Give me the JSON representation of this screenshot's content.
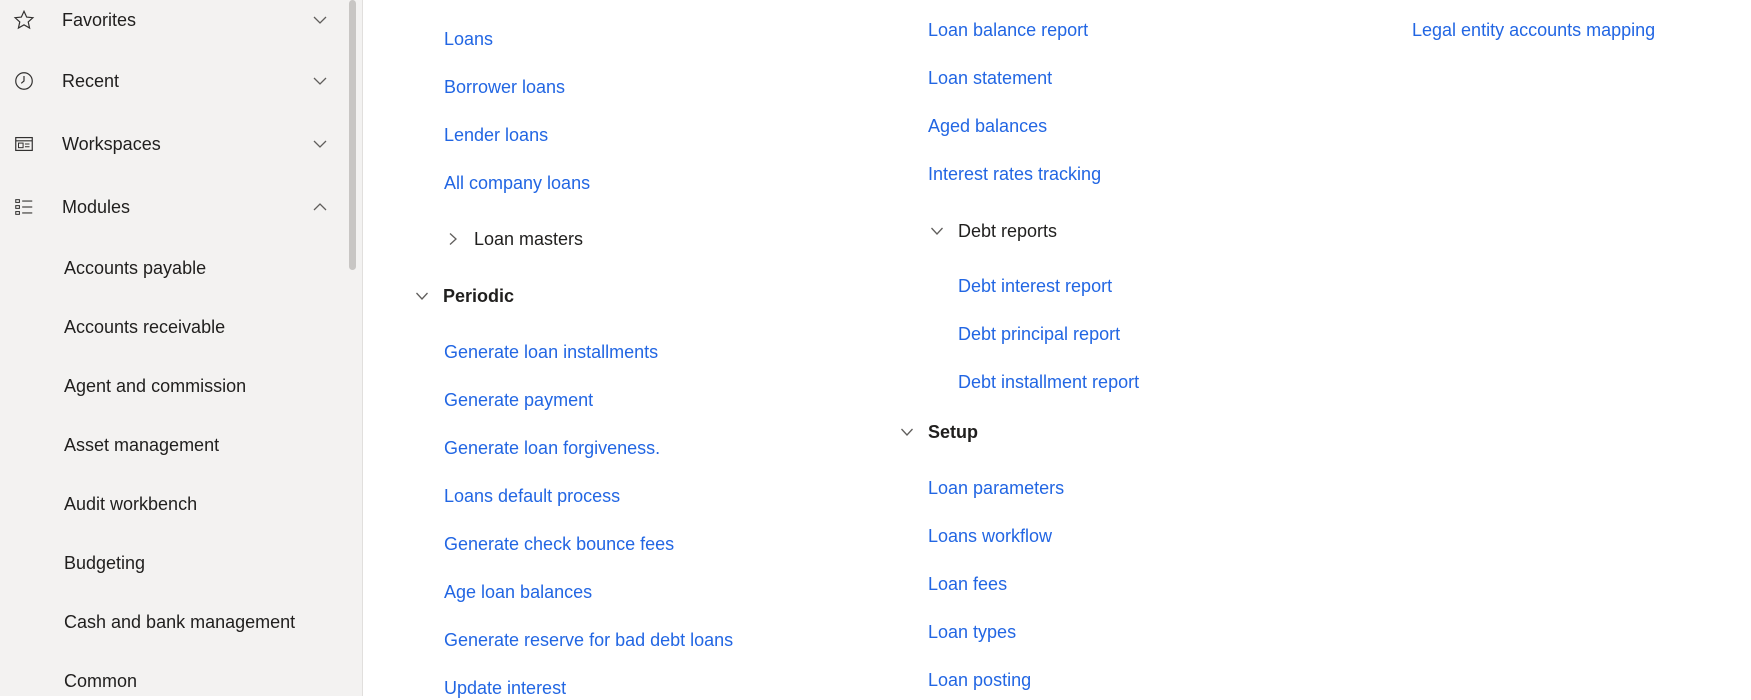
{
  "sidebar": {
    "nav": [
      {
        "label": "Favorites",
        "icon": "star-icon",
        "expanded": false
      },
      {
        "label": "Recent",
        "icon": "clock-icon",
        "expanded": false
      },
      {
        "label": "Workspaces",
        "icon": "workspace-icon",
        "expanded": false
      },
      {
        "label": "Modules",
        "icon": "modules-list-icon",
        "expanded": true
      }
    ],
    "modules": [
      "Accounts payable",
      "Accounts receivable",
      "Agent and commission",
      "Asset management",
      "Audit workbench",
      "Budgeting",
      "Cash and bank management",
      "Common"
    ]
  },
  "column1": {
    "links": [
      "Loans",
      "Borrower loans",
      "Lender loans",
      "All company loans"
    ],
    "loan_masters": {
      "label": "Loan masters",
      "expanded": false
    },
    "periodic": {
      "label": "Periodic",
      "expanded": true,
      "links": [
        "Generate loan installments",
        "Generate payment",
        "Generate loan forgiveness.",
        "Loans default process",
        "Generate check bounce fees",
        "Age loan balances",
        "Generate reserve for bad debt loans",
        "Update interest"
      ]
    }
  },
  "column2": {
    "links": [
      "Loan balance report",
      "Loan statement",
      "Aged balances",
      "Interest rates tracking"
    ],
    "debt_reports": {
      "label": "Debt reports",
      "expanded": true,
      "links": [
        "Debt interest report",
        "Debt principal report",
        "Debt installment report"
      ]
    },
    "setup": {
      "label": "Setup",
      "expanded": true,
      "links": [
        "Loan parameters",
        "Loans workflow",
        "Loan fees",
        "Loan types",
        "Loan posting"
      ]
    }
  },
  "column3": {
    "links": [
      "Legal entity accounts mapping"
    ]
  },
  "colors": {
    "link": "#2266e3",
    "sidebar_bg": "#f3f2f1",
    "text": "#201f1e"
  }
}
